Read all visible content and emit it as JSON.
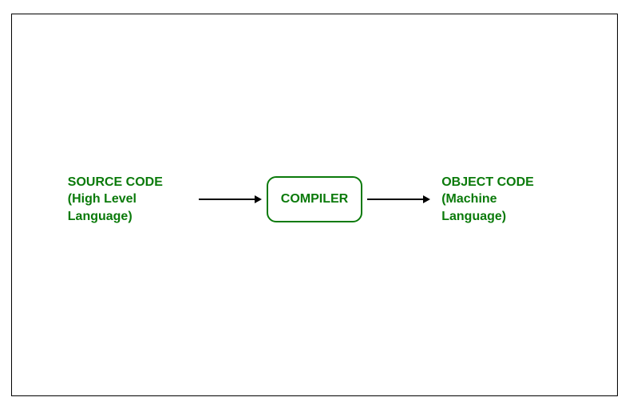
{
  "diagram": {
    "source": {
      "line1": "SOURCE CODE",
      "line2": "(High Level",
      "line3": "Language)"
    },
    "compiler": {
      "label": "COMPILER"
    },
    "object": {
      "line1": "OBJECT CODE",
      "line2": "(Machine",
      "line3": "Language)"
    },
    "colors": {
      "text": "#0a7a0a",
      "border": "#000000"
    }
  }
}
